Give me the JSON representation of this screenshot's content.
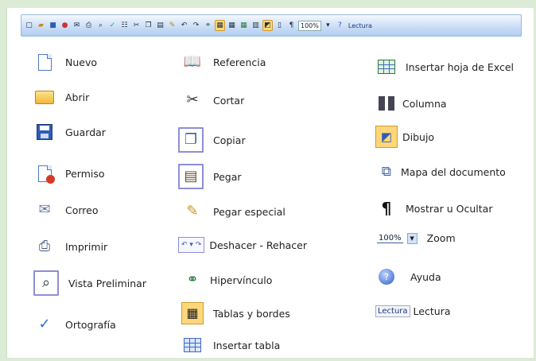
{
  "toolbar": {
    "zoom_value": "100%",
    "lectura_label": "Lectura",
    "buttons": [
      "nuevo",
      "abrir",
      "guardar",
      "permiso",
      "correo",
      "imprimir",
      "vista-preliminar",
      "ortografia",
      "referencia",
      "cortar",
      "copiar",
      "pegar",
      "pegar-especial",
      "deshacer",
      "rehacer",
      "hipervinculo",
      "tablas-y-bordes",
      "insertar-tabla",
      "insertar-hoja-excel",
      "columna",
      "dibujo",
      "mapa-documento",
      "mostrar-ocultar",
      "ayuda"
    ]
  },
  "items": {
    "nuevo": "Nuevo",
    "abrir": "Abrir",
    "guardar": "Guardar",
    "permiso": "Permiso",
    "correo": "Correo",
    "imprimir": "Imprimir",
    "vista_preliminar": "Vista Preliminar",
    "ortografia": "Ortografía",
    "referencia": "Referencia",
    "cortar": "Cortar",
    "copiar": "Copiar",
    "pegar": "Pegar",
    "pegar_especial": "Pegar especial",
    "deshacer_rehacer": "Deshacer - Rehacer",
    "hipervinculo": "Hipervínculo",
    "tablas_bordes": "Tablas y bordes",
    "insertar_tabla": "Insertar tabla",
    "insertar_excel": "Insertar hoja de Excel",
    "columna": "Columna",
    "dibujo": "Dibujo",
    "mapa_documento": "Mapa del documento",
    "mostrar_ocultar": "Mostrar u Ocultar",
    "zoom": "Zoom",
    "zoom_value": "100%",
    "ayuda": "Ayuda",
    "lectura": "Lectura",
    "lectura_chip": "Lectura"
  },
  "colors": {
    "background": "#dcebd5",
    "toolbar": "#c9dcf6",
    "highlight": "#ffd77a",
    "icon_frame": "#8d8fd6"
  }
}
